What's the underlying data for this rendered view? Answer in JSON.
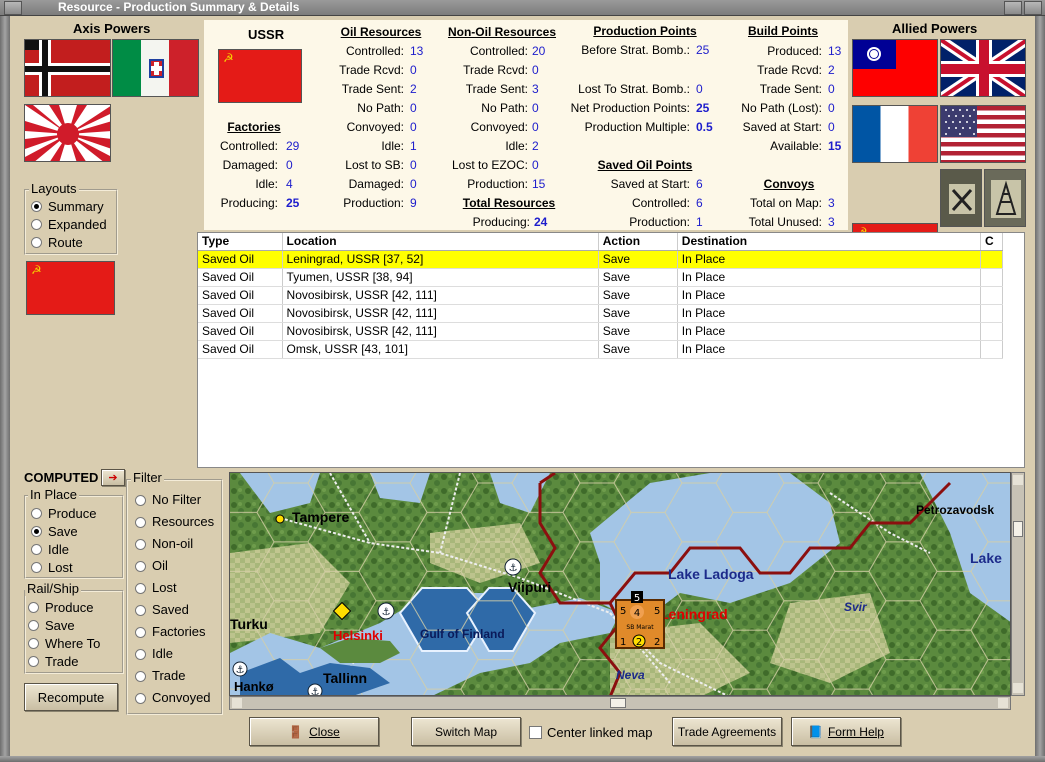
{
  "window": {
    "title": "Resource - Production Summary & Details"
  },
  "axis": {
    "title": "Axis Powers"
  },
  "allied": {
    "title": "Allied Powers"
  },
  "layouts": {
    "title": "Layouts",
    "options": [
      "Summary",
      "Expanded",
      "Route"
    ],
    "selected": "Summary"
  },
  "summary": {
    "country": "USSR",
    "factories": {
      "title": "Factories",
      "rows": [
        {
          "label": "Controlled:",
          "value": "29"
        },
        {
          "label": "Damaged:",
          "value": "0"
        },
        {
          "label": "Idle:",
          "value": "4"
        },
        {
          "label": "Producing:",
          "value": "25"
        }
      ]
    },
    "oil": {
      "title": "Oil Resources",
      "rows": [
        {
          "label": "Controlled:",
          "value": "13"
        },
        {
          "label": "Trade Rcvd:",
          "value": "0"
        },
        {
          "label": "Trade Sent:",
          "value": "2"
        },
        {
          "label": "No Path:",
          "value": "0"
        },
        {
          "label": "Convoyed:",
          "value": "0"
        },
        {
          "label": "Idle:",
          "value": "1"
        },
        {
          "label": "Lost to SB:",
          "value": "0"
        },
        {
          "label": "Damaged:",
          "value": "0"
        },
        {
          "label": "Production:",
          "value": "9"
        }
      ]
    },
    "nonoil": {
      "title": "Non-Oil Resources",
      "rows": [
        {
          "label": "Controlled:",
          "value": "20"
        },
        {
          "label": "Trade Rcvd:",
          "value": "0"
        },
        {
          "label": "Trade Sent:",
          "value": "3"
        },
        {
          "label": "No Path:",
          "value": "0"
        },
        {
          "label": "Convoyed:",
          "value": "0"
        },
        {
          "label": "Idle:",
          "value": "2"
        },
        {
          "label": "Lost to EZOC:",
          "value": "0"
        },
        {
          "label": "Production:",
          "value": "15"
        }
      ]
    },
    "total": {
      "title": "Total Resources",
      "label": "Producing:",
      "value": "24"
    },
    "pp": {
      "title": "Production Points",
      "rows": [
        {
          "label": "Before Strat. Bomb.:",
          "value": "25"
        },
        {
          "label": "Lost To Strat. Bomb.:",
          "value": "0"
        },
        {
          "label": "Net Production Points:",
          "value": "25"
        },
        {
          "label": "Production Multiple:",
          "value": "0.5"
        }
      ]
    },
    "savedoil": {
      "title": "Saved Oil Points",
      "rows": [
        {
          "label": "Saved at Start:",
          "value": "6"
        },
        {
          "label": "Controlled:",
          "value": "6"
        },
        {
          "label": "Production:",
          "value": "1"
        }
      ]
    },
    "build": {
      "title": "Build Points",
      "rows": [
        {
          "label": "Produced:",
          "value": "13"
        },
        {
          "label": "Trade Rcvd:",
          "value": "2"
        },
        {
          "label": "Trade Sent:",
          "value": "0"
        },
        {
          "label": "No Path (Lost):",
          "value": "0"
        },
        {
          "label": "Saved at Start:",
          "value": "0"
        },
        {
          "label": "Available:",
          "value": "15"
        }
      ]
    },
    "convoys": {
      "title": "Convoys",
      "rows": [
        {
          "label": "Total on Map:",
          "value": "3"
        },
        {
          "label": "Total Unused:",
          "value": "3"
        }
      ]
    }
  },
  "table": {
    "columns": [
      "Type",
      "Location",
      "Action",
      "Destination",
      "C"
    ],
    "rows": [
      [
        "Saved Oil",
        "Leningrad, USSR [37, 52]",
        "Save",
        "In Place",
        ""
      ],
      [
        "Saved Oil",
        "Tyumen, USSR [38, 94]",
        "Save",
        "In Place",
        ""
      ],
      [
        "Saved Oil",
        "Novosibirsk, USSR [42, 111]",
        "Save",
        "In Place",
        ""
      ],
      [
        "Saved Oil",
        "Novosibirsk, USSR [42, 111]",
        "Save",
        "In Place",
        ""
      ],
      [
        "Saved Oil",
        "Novosibirsk, USSR [42, 111]",
        "Save",
        "In Place",
        ""
      ],
      [
        "Saved Oil",
        "Omsk, USSR [43, 101]",
        "Save",
        "In Place",
        ""
      ]
    ]
  },
  "computed": {
    "label": "COMPUTED"
  },
  "inplace": {
    "title": "In Place",
    "options": [
      "Produce",
      "Save",
      "Idle",
      "Lost"
    ],
    "selected": "Save"
  },
  "railship": {
    "title": "Rail/Ship",
    "options": [
      "Produce",
      "Save",
      "Where To",
      "Trade"
    ]
  },
  "filter": {
    "title": "Filter",
    "options": [
      "No Filter",
      "Resources",
      "Non-oil",
      "Oil",
      "Lost",
      "Saved",
      "Factories",
      "Idle",
      "Trade",
      "Convoyed"
    ]
  },
  "buttons": {
    "recompute": "Recompute",
    "close": "Close",
    "switch_map": "Switch Map",
    "center_linked": "Center linked map",
    "trade_agreements": "Trade Agreements",
    "form_help": "Form Help"
  },
  "map": {
    "labels": [
      "Tampere",
      "Viipuri",
      "Lake Ladoga",
      "Petrozavodsk",
      "Lake",
      "Turku",
      "Helsinki",
      "Gulf of Finland",
      "Leningrad",
      "Svir",
      "Tallinn",
      "Hankø",
      "Neva"
    ],
    "unit": {
      "attack": "5",
      "defense": "4",
      "move": "5",
      "stack": "5",
      "a": "1",
      "b": "2",
      "c": "2",
      "name": "SB Marat"
    }
  },
  "colors": {
    "highlight": "#ffff00",
    "value": "#1d1dcc",
    "ussr_red": "#e41b17"
  }
}
